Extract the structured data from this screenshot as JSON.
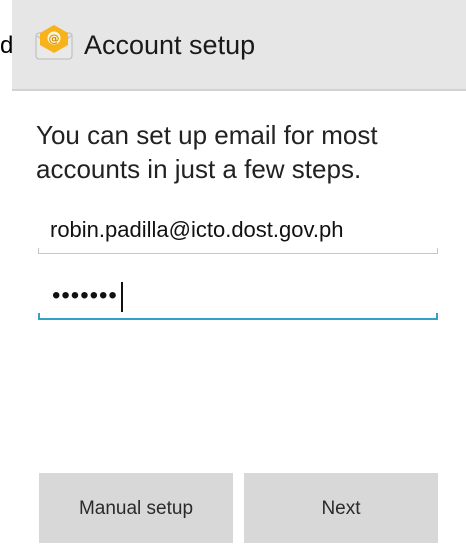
{
  "background": {
    "partial_text": "d"
  },
  "action_bar": {
    "icon": "email-app-icon",
    "title": "Account setup"
  },
  "intro": {
    "text": "You can set up email for most accounts in just a few steps."
  },
  "email_field": {
    "value": "robin.padilla@icto.dost.gov.ph"
  },
  "password_field": {
    "masked_value": "•••••••",
    "focused": true
  },
  "buttons": {
    "manual_setup": "Manual setup",
    "next": "Next"
  },
  "colors": {
    "action_bar": "#e6e6e6",
    "focus_accent": "#33a0c8",
    "button": "#d8d8d8",
    "icon_envelope": "#f7b21c"
  }
}
